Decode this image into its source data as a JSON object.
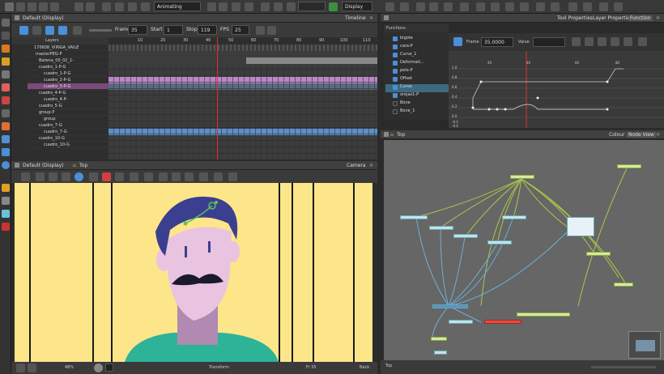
{
  "toolbar": {
    "mode": "Animating",
    "display": "Display"
  },
  "timeline": {
    "view_select": "Default (Display)",
    "title": "Timeline",
    "frame_label": "Frame",
    "frame_value": "35",
    "start_label": "Start",
    "start_value": "1",
    "stop_label": "Stop",
    "stop_value": "119",
    "fps_label": "FPS",
    "fps_value": "25",
    "layers_label": "Layers",
    "ruler": [
      "10",
      "20",
      "30",
      "40",
      "50",
      "60",
      "70",
      "80",
      "90",
      "100",
      "110"
    ],
    "layers": [
      {
        "name": "170608_VIINGA_VAILE",
        "indent": 0
      },
      {
        "name": "masterPEG-P",
        "indent": 0
      },
      {
        "name": "Batena_00_02_1-",
        "indent": 1
      },
      {
        "name": "cuadro_1-P-G",
        "indent": 1
      },
      {
        "name": "cuadro_1-P-G",
        "indent": 2
      },
      {
        "name": "cuadro_2-P-G",
        "indent": 2
      },
      {
        "name": "cuadro_3-P-G",
        "indent": 2
      },
      {
        "name": "cuadro_4-P-G",
        "indent": 1
      },
      {
        "name": "cuadro_4-P-",
        "indent": 2
      },
      {
        "name": "cuadro_5-G",
        "indent": 1
      },
      {
        "name": "group-P",
        "indent": 1
      },
      {
        "name": "group",
        "indent": 2
      },
      {
        "name": "cuadro_7-G",
        "indent": 1
      },
      {
        "name": "cuadro_7-G",
        "indent": 2
      },
      {
        "name": "cuadro_10-G",
        "indent": 1
      },
      {
        "name": "cuadro_10-G",
        "indent": 2
      }
    ]
  },
  "camera": {
    "view_select": "Default (Display)",
    "breadcrumb": "Top",
    "title": "Camera",
    "status": "Transform",
    "fr": "Fr 35",
    "bg": "Back",
    "zoom": "48%"
  },
  "properties": {
    "tabs": [
      "Tool Properties",
      "Layer Properties",
      "Function"
    ],
    "frame_label": "Frame",
    "frame_value": "35.0000",
    "value_label": "Value"
  },
  "functions": {
    "title": "Functions",
    "items": [
      "bigote",
      "cara-P",
      "Curve_1",
      "Deformati...",
      "pelo-P",
      "Offset",
      "Curve",
      "orejas1-P",
      "Bone",
      "Bone_1"
    ],
    "x_ticks": [
      "20",
      "40",
      "60",
      "80"
    ],
    "y_ticks": [
      "1.0",
      "0.8",
      "0.6",
      "0.4",
      "0.2",
      "0.0",
      "-0.2",
      "-0.4"
    ]
  },
  "node_view": {
    "breadcrumb": "Top",
    "tabs": [
      "Colour",
      "Node View"
    ],
    "footer": "Top"
  },
  "colors": {
    "accent": "#4a90d9",
    "canvas": "#fde58a",
    "skin": "#e8c4e0",
    "hair": "#3b3f8f",
    "shirt": "#2db398",
    "peg": "#8cc63f"
  }
}
